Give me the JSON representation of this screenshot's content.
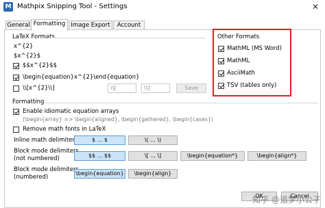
{
  "window": {
    "icon_text": "M",
    "title": "Mathpix Snipping Tool - Settings",
    "close_glyph": "✕"
  },
  "tabs": [
    {
      "label": "General"
    },
    {
      "label": "Formatting"
    },
    {
      "label": "Image Export"
    },
    {
      "label": "Account"
    }
  ],
  "latex_formats": {
    "group_title": "LaTeX Formats",
    "example1": "x^{2}",
    "example2": "$x^{2}$",
    "options": [
      {
        "label": "$$x^{2}$$",
        "checked": true
      },
      {
        "label": "\\begin{equation}x^{2}\\end{equation}",
        "checked": true
      },
      {
        "label": "\\\\[x^{2}\\\\]",
        "checked": false
      }
    ],
    "custom_open": "\\\\[",
    "custom_close": "\\\\]",
    "save_label": "Save"
  },
  "other_formats": {
    "group_title": "Other Formats",
    "options": [
      {
        "label": "MathML (MS Word)",
        "checked": true
      },
      {
        "label": "MathML",
        "checked": true
      },
      {
        "label": "AsciiMath",
        "checked": true
      },
      {
        "label": "TSV (tables only)",
        "checked": true
      }
    ]
  },
  "formatting": {
    "group_title": "Formatting",
    "idiomatic": {
      "label": "Enable idiomatic equation arrays",
      "checked": true
    },
    "idiomatic_hint": "(\\begin{array} => \\begin{aligned}, \\begin{gathered}, \\begin{cases})",
    "remove_fonts": {
      "label": "Remove math fonts in LaTeX",
      "checked": false
    },
    "inline_label": "Inline math delimiters",
    "inline_options": [
      "$ ... $",
      "\\( ... \\)"
    ],
    "block_label_1": "Block mode delimiters",
    "block_label_2": "(not numbered)",
    "block_options": [
      "$$ ... $$",
      "\\[ ... \\]",
      "\\begin{equation*}",
      "\\begin{align*}"
    ],
    "block_num_label_1": "Block mode delimiters",
    "block_num_label_2": "(numbered)",
    "block_num_options": [
      "\\begin{equation}",
      "\\begin{align}"
    ]
  },
  "footer": {
    "ok_label": "OK",
    "cancel_label": "Cancel"
  },
  "watermark": "知乎 @追梦小公子",
  "colors": {
    "highlight_box": "#e02020",
    "selected_button": "#cce4f7",
    "app_icon": "#2b6cb0"
  }
}
